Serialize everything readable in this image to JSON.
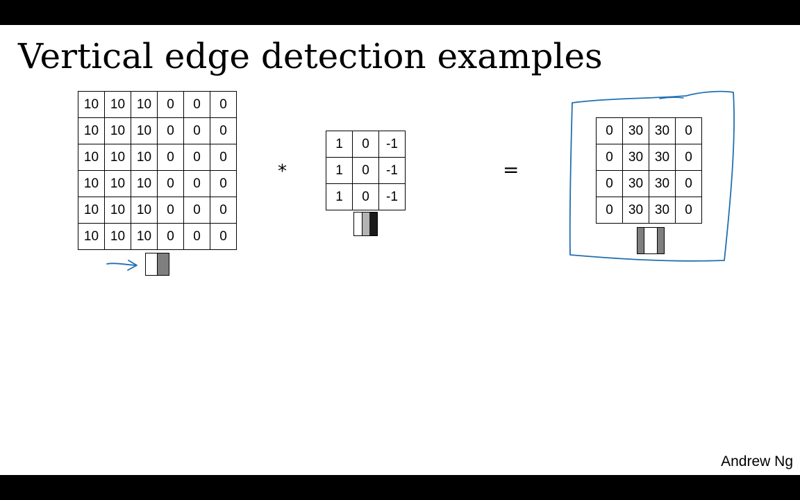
{
  "slide": {
    "title": "Vertical edge detection examples",
    "author": "Andrew Ng"
  },
  "input_matrix": [
    [
      "10",
      "10",
      "10",
      "0",
      "0",
      "0"
    ],
    [
      "10",
      "10",
      "10",
      "0",
      "0",
      "0"
    ],
    [
      "10",
      "10",
      "10",
      "0",
      "0",
      "0"
    ],
    [
      "10",
      "10",
      "10",
      "0",
      "0",
      "0"
    ],
    [
      "10",
      "10",
      "10",
      "0",
      "0",
      "0"
    ],
    [
      "10",
      "10",
      "10",
      "0",
      "0",
      "0"
    ]
  ],
  "filter_matrix": [
    [
      "1",
      "0",
      "-1"
    ],
    [
      "1",
      "0",
      "-1"
    ],
    [
      "1",
      "0",
      "-1"
    ]
  ],
  "output_matrix": [
    [
      "0",
      "30",
      "30",
      "0"
    ],
    [
      "0",
      "30",
      "30",
      "0"
    ],
    [
      "0",
      "30",
      "30",
      "0"
    ],
    [
      "0",
      "30",
      "30",
      "0"
    ]
  ],
  "operators": {
    "convolve": "*",
    "equals": "="
  },
  "colors": {
    "annotation_ink": "#1f6fb2",
    "white": "#ffffff",
    "light_gray": "#b3b3b3",
    "gray": "#7f7f7f",
    "dark": "#1a1a1a"
  },
  "icons": {
    "input_image": "white-gray-split-icon",
    "filter_image": "white-gray-black-stripes-icon",
    "output_image": "gray-white-gray-stripes-icon",
    "annotation_arrow": "hand-drawn-arrow-icon"
  }
}
